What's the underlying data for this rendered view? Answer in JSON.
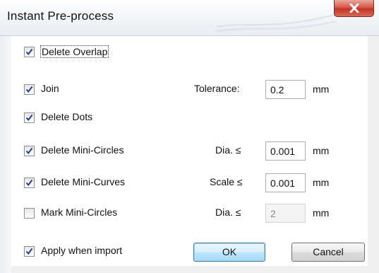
{
  "dialog": {
    "title": "Instant Pre-process"
  },
  "options": {
    "delete_overlap": {
      "label": "Delete Overlap",
      "checked": true
    },
    "join": {
      "label": "Join",
      "checked": true
    },
    "delete_dots": {
      "label": "Delete Dots",
      "checked": true
    },
    "delete_mini_circles": {
      "label": "Delete Mini-Circles",
      "checked": true
    },
    "delete_mini_curves": {
      "label": "Delete Mini-Curves",
      "checked": true
    },
    "mark_mini_circles": {
      "label": "Mark Mini-Circles",
      "checked": false
    },
    "apply_when_import": {
      "label": "Apply when import",
      "checked": true
    }
  },
  "params": {
    "tolerance": {
      "label": "Tolerance:",
      "value": "0.2",
      "unit": "mm"
    },
    "circles_dia": {
      "label": "Dia. ≤",
      "value": "0.001",
      "unit": "mm"
    },
    "curves_scale": {
      "label": "Scale ≤",
      "value": "0.001",
      "unit": "mm"
    },
    "mark_dia": {
      "label": "Dia. ≤",
      "value": "2",
      "unit": "mm",
      "disabled": true
    }
  },
  "buttons": {
    "ok": "OK",
    "cancel": "Cancel"
  }
}
